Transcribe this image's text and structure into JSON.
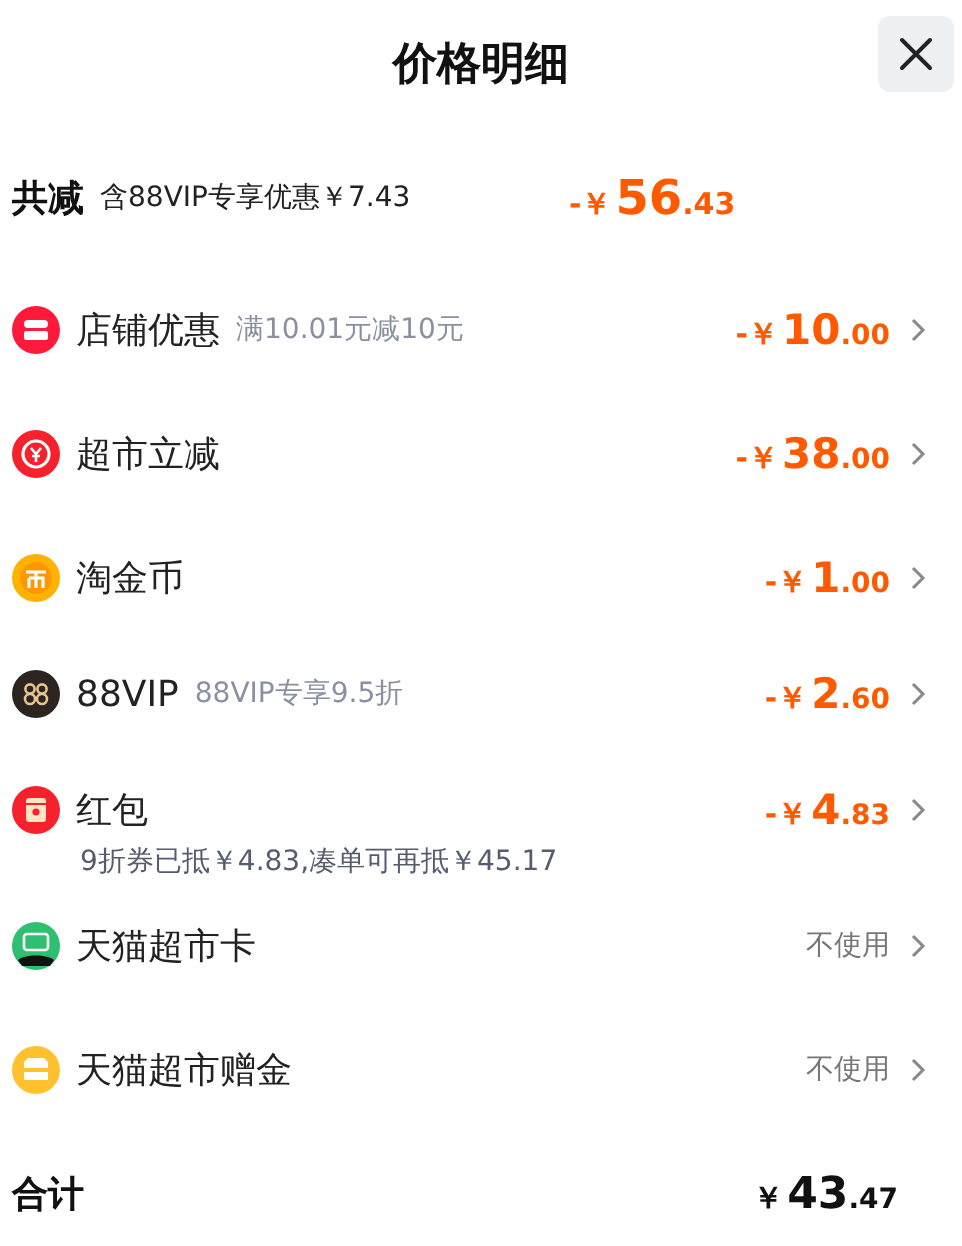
{
  "title": "价格明细",
  "summary": {
    "label": "共减",
    "note": "含88VIP专享优惠￥7.43",
    "sign": "-￥",
    "int": "56",
    "dec": ".43"
  },
  "items": [
    {
      "kind": "shop",
      "label": "店铺优惠",
      "note": "满10.01元减10元",
      "sign": "-￥",
      "int": "10",
      "dec": ".00"
    },
    {
      "kind": "yen",
      "label": "超市立减",
      "sign": "-￥",
      "int": "38",
      "dec": ".00"
    },
    {
      "kind": "coin",
      "label": "淘金币",
      "sign": "-￥",
      "int": "1",
      "dec": ".00"
    },
    {
      "kind": "vip",
      "label": "88VIP",
      "note": "88VIP专享9.5折",
      "sign": "-￥",
      "int": "2",
      "dec": ".60"
    },
    {
      "kind": "redpacket",
      "label": "红包",
      "sub": "9折券已抵￥4.83,凑单可再抵￥45.17",
      "sign": "-￥",
      "int": "4",
      "dec": ".83"
    },
    {
      "kind": "card",
      "label": "天猫超市卡",
      "status": "不使用"
    },
    {
      "kind": "gift",
      "label": "天猫超市赠金",
      "status": "不使用"
    }
  ],
  "total": {
    "label": "合计",
    "sign": "￥",
    "int": "43",
    "dec": ".47"
  }
}
